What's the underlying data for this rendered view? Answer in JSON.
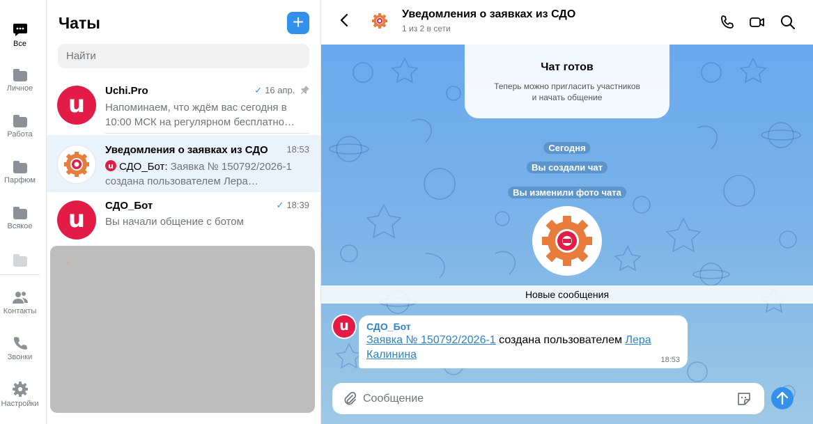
{
  "folders": [
    {
      "label": "Все",
      "icon": "chat-bubble-icon",
      "active": true
    },
    {
      "label": "Личное",
      "icon": "folder-icon"
    },
    {
      "label": "Работа",
      "icon": "folder-icon"
    },
    {
      "label": "Парфюм",
      "icon": "folder-icon"
    },
    {
      "label": "Всякое",
      "icon": "folder-icon"
    },
    {
      "label": "",
      "icon": "folder-icon"
    }
  ],
  "rail_bottom": [
    {
      "label": "Контакты",
      "icon": "contacts-icon"
    },
    {
      "label": "Звонки",
      "icon": "phone-icon"
    },
    {
      "label": "Настройки",
      "icon": "gear-icon"
    }
  ],
  "list": {
    "title": "Чаты",
    "new_button": "+",
    "search_placeholder": "Найти"
  },
  "chats": [
    {
      "name": "Uchi.Pro",
      "time": "16 апр.",
      "read": true,
      "pinned": true,
      "preview": "Напоминаем, что ждём вас сегодня в 10:00 МСК на регулярном бесплатно…"
    },
    {
      "name": "Уведомления о заявках из СДО",
      "time": "18:53",
      "selected": true,
      "sender": "СДО_Бот:",
      "preview": "Заявка № 150792/2026-1 создана пользователем Лера…"
    },
    {
      "name": "СДО_Бот",
      "time": "18:39",
      "read": true,
      "preview": "Вы начали общение с ботом"
    }
  ],
  "header": {
    "back": "‹",
    "title": "Уведомления о заявках из СДО",
    "subtitle": "1 из 2 в сети"
  },
  "conversation": {
    "card_title": "Чат готов",
    "card_text_1": "Теперь можно пригласить участников",
    "card_text_2": "и начать общение",
    "service": [
      "Сегодня",
      "Вы создали чат",
      "Вы изменили фото чата"
    ],
    "new_messages": "Новые сообщения",
    "message": {
      "from": "СДО_Бот",
      "link1": "Заявка № 150792/2026-1",
      "middle": " создана пользователем ",
      "link2": "Лера Калинина",
      "time": "18:53"
    },
    "composer_placeholder": "Сообщение"
  },
  "colors": {
    "accent": "#3390ec",
    "brand_red": "#e31c47",
    "selected_row": "#eaf2fb"
  }
}
